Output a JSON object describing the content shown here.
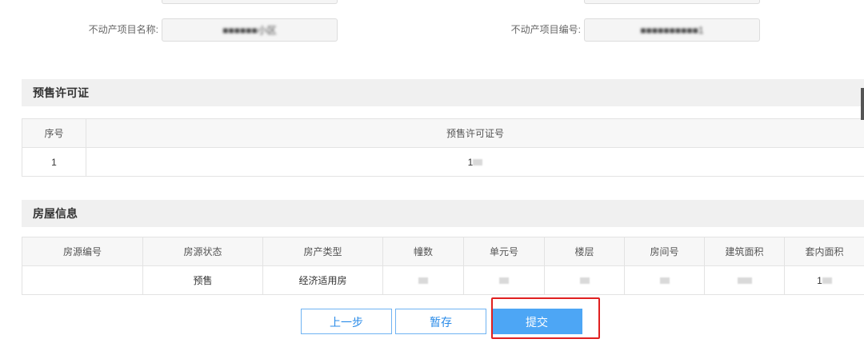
{
  "form": {
    "project_name_label": "不动产项目名称:",
    "project_name_value": "■■■■■■小区",
    "project_no_label": "不动产项目编号:",
    "project_no_value": "■■■■■■■■■■1"
  },
  "presale": {
    "title": "预售许可证",
    "headers": [
      "序号",
      "预售许可证号"
    ],
    "rows": [
      {
        "index": "1",
        "license_no": "1"
      }
    ]
  },
  "house": {
    "title": "房屋信息",
    "headers": [
      "房源编号",
      "房源状态",
      "房产类型",
      "幢数",
      "单元号",
      "楼层",
      "房间号",
      "建筑面积",
      "套内面积"
    ],
    "rows": [
      {
        "source_no": "",
        "status": "预售",
        "type": "经济适用房",
        "building": "",
        "unit": "",
        "floor": "",
        "room": "",
        "area": "",
        "inner_area": "1"
      }
    ]
  },
  "actions": {
    "prev_label": "上一步",
    "save_label": "暂存",
    "submit_label": "提交"
  },
  "colors": {
    "primary": "#4da6f5",
    "outline": "#2a8be8",
    "highlight": "#e02020",
    "section_bg": "#f0f0f0"
  }
}
